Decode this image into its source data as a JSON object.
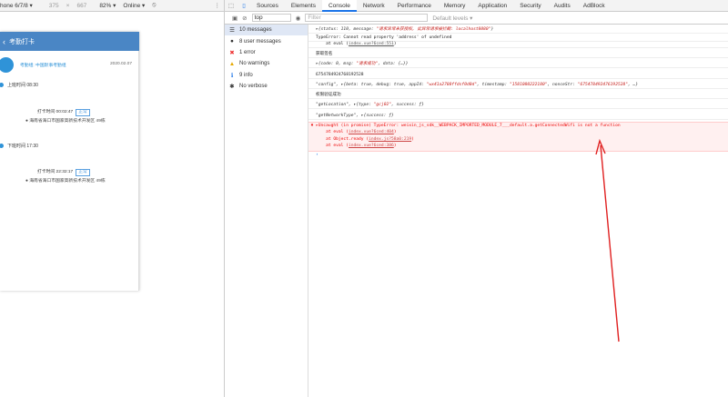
{
  "device_toolbar": {
    "device": "hone 6/7/8 ▾",
    "width": "375",
    "x": "×",
    "height": "667",
    "zoom": "82% ▾",
    "network": "Online ▾"
  },
  "app": {
    "title": "考勤打卡",
    "user_name": "考勤组: 中国默事考勤组",
    "date": "2020.02.07",
    "entries": [
      {
        "label": "上班时间 08:30",
        "punch": "打卡时间 00:02:47",
        "tag": "正常",
        "location": "海南省海口市国家高新技术开发区 49栋"
      },
      {
        "label": "下班时间 17:30",
        "punch": "打卡时间 22:32:17",
        "tag": "正常",
        "location": "海南省海口市国家高新技术开发区 49栋"
      }
    ]
  },
  "devtools": {
    "tabs": [
      "Sources",
      "Elements",
      "Console",
      "Network",
      "Performance",
      "Memory",
      "Application",
      "Security",
      "Audits",
      "AdBlock"
    ],
    "active_tab": "Console",
    "context": "top",
    "filter_placeholder": "Filter",
    "levels": "Default levels ▾",
    "sidebar": [
      {
        "icon": "list-icon",
        "label": "10 messages"
      },
      {
        "icon": "user-icon",
        "label": "8 user messages"
      },
      {
        "icon": "error-icon",
        "label": "1 error"
      },
      {
        "icon": "warning-icon",
        "label": "No warnings"
      },
      {
        "icon": "info-icon",
        "label": "9 info"
      },
      {
        "icon": "verbose-icon",
        "label": "No verbose"
      }
    ],
    "console": {
      "l1": {
        "pre": "▸{status: 110, message: ",
        "str": "\"请求异常未获授权, 此异常请求被拦截: localhost8080\"",
        "post": "}"
      },
      "l2": "TypeError: Cannot read property 'address' of undefined",
      "l3": {
        "text": "    at eval (",
        "link": "index.vue?6ced:551",
        "post": ")"
      },
      "l4": "获取签名",
      "l5": {
        "pre": "▸{code: 0, msg: ",
        "str": "\"请求成功\"",
        "post": ", data: {…}}"
      },
      "l6": "6754784924768192528",
      "l7": {
        "pre": "\"config\", ▸{beta: true, debug: true, appId: ",
        "str": "\"wx41a2780ffdsf0d0d\"",
        "mid": ", timestamp: ",
        "str2": "\"1581080222180\"",
        "mid2": ", nonceStr: ",
        "str3": "\"675478492476192528\"",
        "post": ", …}"
      },
      "l8": "权限验证成功",
      "l9": {
        "pre": "\"getLocation\", ▸{type: ",
        "str": "\"gcj02\"",
        "post": ", success: ƒ}"
      },
      "l10": "\"getNetworkType\", ▸{success: ƒ}",
      "e1": "▸Uncaught (in promise) TypeError: weixin_js_sdk__WEBPACK_IMPORTED_MODULE_7___default.a.getConnectedWifi is not a function",
      "e2": {
        "text": "    at eval (",
        "link": "index.vue?6ced:404",
        "post": ")"
      },
      "e3": {
        "text": "    at Object.ready (",
        "link": "index.js?58a0:219",
        "post": ")"
      },
      "e4": {
        "text": "    at eval (",
        "link": "index.vue?6ced:386",
        "post": ")"
      },
      "prompt": "›"
    }
  }
}
